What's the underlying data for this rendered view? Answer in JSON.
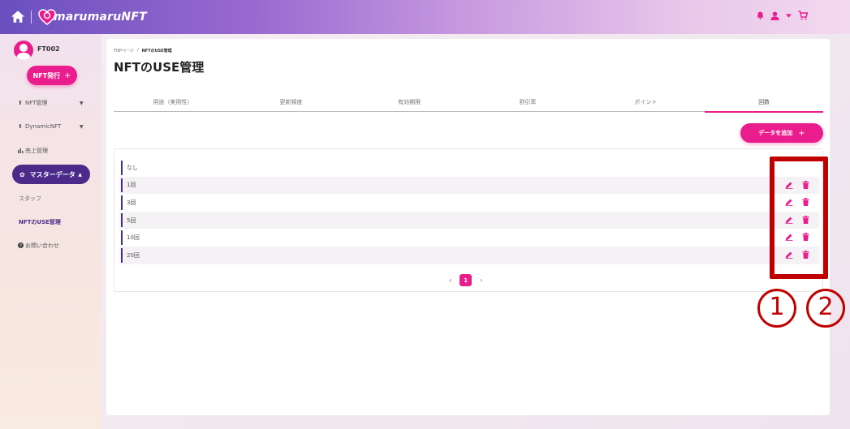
{
  "header": {
    "brand": "marumaruNFT",
    "colors": {
      "accent": "#ea1d8c",
      "primary_dark": "#4b2a8a",
      "annotation": "#c00000"
    }
  },
  "user": {
    "name": "FT002"
  },
  "sidebar": {
    "issue_button": "NFT発行",
    "items": [
      {
        "label": "NFT管理",
        "icon": "upload-icon"
      },
      {
        "label": "DynamicNFT",
        "icon": "upload-icon"
      },
      {
        "label": "売上管理",
        "icon": "bar-chart-icon"
      }
    ],
    "master": {
      "label": "マスターデータ",
      "icon": "gear-icon"
    },
    "sub_items": [
      {
        "label": "スタッフ"
      },
      {
        "label": "NFTのUSE管理"
      }
    ],
    "contact": {
      "label": "お問い合わせ",
      "icon": "question-icon"
    }
  },
  "breadcrumb": {
    "root": "TOPページ",
    "separator": "/",
    "current": "NFTのUSE管理"
  },
  "page": {
    "title": "NFTのUSE管理"
  },
  "tabs": [
    {
      "label": "用途（実用性）"
    },
    {
      "label": "更新頻度"
    },
    {
      "label": "有効期限"
    },
    {
      "label": "割引率"
    },
    {
      "label": "ポイント"
    },
    {
      "label": "回数",
      "active": true
    }
  ],
  "add_button": "データを追加",
  "rows": [
    {
      "label": "なし",
      "editable": false
    },
    {
      "label": "1回",
      "editable": true
    },
    {
      "label": "3回",
      "editable": true
    },
    {
      "label": "5回",
      "editable": true
    },
    {
      "label": "10回",
      "editable": true
    },
    {
      "label": "20回",
      "editable": true
    }
  ],
  "pagination": {
    "prev": "‹",
    "current": "1",
    "next": "›"
  },
  "annotations": {
    "edit_marker": "①",
    "delete_marker": "②"
  }
}
